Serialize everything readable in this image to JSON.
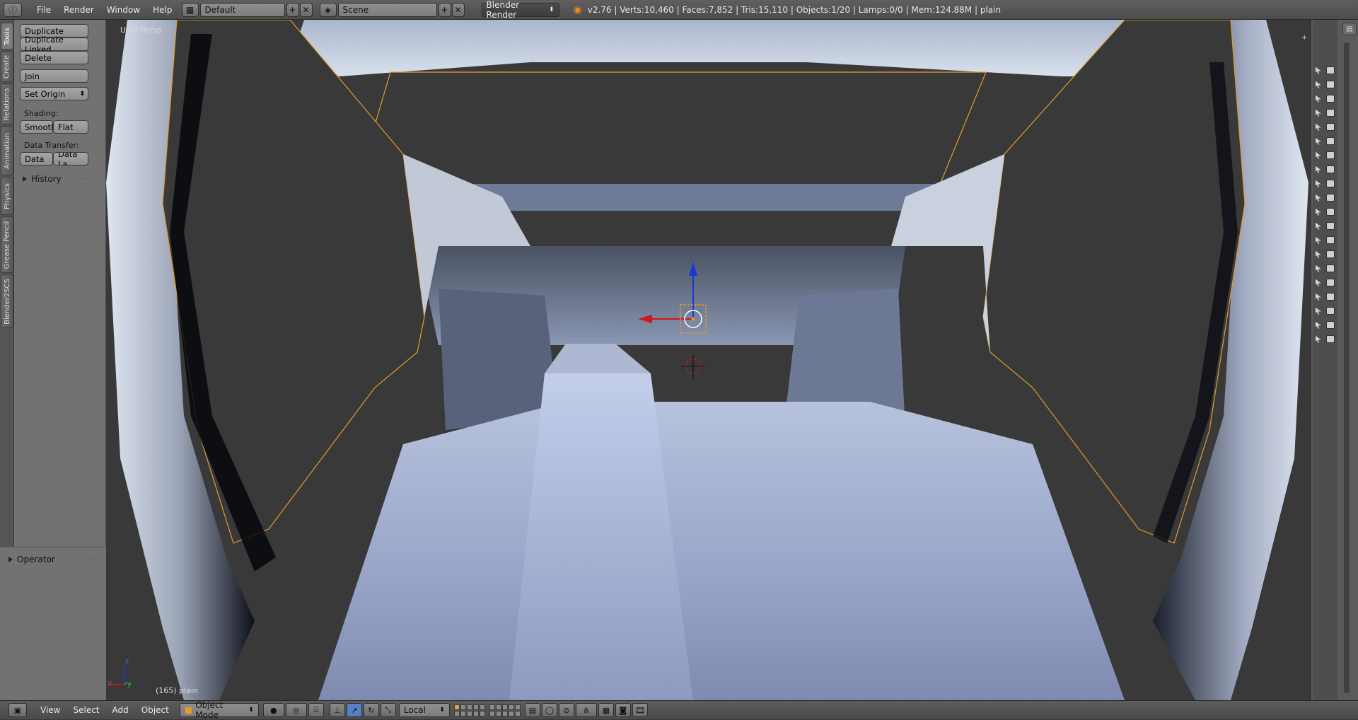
{
  "menu": {
    "items": [
      "File",
      "Render",
      "Window",
      "Help"
    ]
  },
  "header": {
    "screen_layout": "Default",
    "scene": "Scene",
    "render_engine": "Blender Render",
    "stats": "v2.76 | Verts:10,460 | Faces:7,852 | Tris:15,110 | Objects:1/20 | Lamps:0/0 | Mem:124.88M | plain"
  },
  "tabs": [
    "Tools",
    "Create",
    "Relations",
    "Animation",
    "Physics",
    "Grease Pencil",
    "Blender2SCS"
  ],
  "tools": {
    "duplicate": "Duplicate",
    "duplicate_linked": "Duplicate Linked",
    "delete": "Delete",
    "join": "Join",
    "set_origin": "Set Origin",
    "shading_label": "Shading:",
    "smooth": "Smooth",
    "flat": "Flat",
    "data_transfer_label": "Data Transfer:",
    "data": "Data",
    "data_layout": "Data La",
    "history": "History"
  },
  "operator": {
    "title": "Operator"
  },
  "viewport": {
    "view_name": "User Persp",
    "object_info": "(165) plain",
    "axis_x": "x",
    "axis_y": "y",
    "axis_z": "z"
  },
  "bottombar": {
    "menus": [
      "View",
      "Select",
      "Add",
      "Object"
    ],
    "mode": "Object Mode",
    "orientation": "Local"
  },
  "colors": {
    "x_axis": "#d01818",
    "y_axis": "#2ea02e",
    "z_axis": "#1b36d6",
    "selection": "#e69a2b"
  }
}
